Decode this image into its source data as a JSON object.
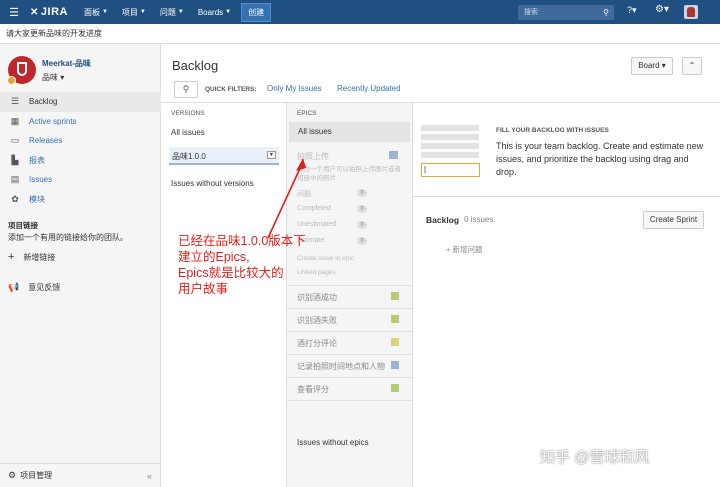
{
  "topbar": {
    "logo": "JIRA",
    "nav": [
      "面板",
      "项目",
      "问题",
      "Boards"
    ],
    "create": "创建",
    "search_placeholder": "搜索"
  },
  "announcement": "请大家更新品味的开发进度",
  "sidebar": {
    "project_name": "Meerkat-品味",
    "project_sub": "品味",
    "items": [
      {
        "label": "Backlog",
        "icon": "backlog-icon"
      },
      {
        "label": "Active sprints",
        "icon": "sprints-icon"
      },
      {
        "label": "Releases",
        "icon": "releases-icon"
      },
      {
        "label": "报表",
        "icon": "reports-icon"
      },
      {
        "label": "Issues",
        "icon": "issues-icon"
      },
      {
        "label": "模块",
        "icon": "components-icon"
      }
    ],
    "links_section": "项目链接",
    "links_desc": "添加一个有用的链接给你的团队。",
    "add_link": "新增链接",
    "feedback": "意见反馈",
    "footer": "项目管理"
  },
  "main": {
    "title": "Backlog",
    "board_button": "Board",
    "quick_filters_label": "QUICK FILTERS:",
    "quick_filters": [
      "Only My Issues",
      "Recently Updated"
    ]
  },
  "versions": {
    "header": "VERSIONS",
    "all": "All issues",
    "items": [
      "品味1.0.0"
    ],
    "none": "Issues without versions"
  },
  "epics": {
    "header": "EPICS",
    "all": "All issues",
    "first": {
      "name": "拍照上传",
      "desc": "作为一个用户可以拍照上传图片或者相册中的照片",
      "stats": [
        {
          "label": "问题",
          "value": "0"
        },
        {
          "label": "Completed",
          "value": "0"
        },
        {
          "label": "Unestimated",
          "value": "0"
        },
        {
          "label": "Estimate",
          "value": "0"
        }
      ],
      "link1": "Create issue in epic",
      "link2": "Linked pages"
    },
    "items": [
      {
        "name": "识别酒成功",
        "color": "#b7cc6e"
      },
      {
        "name": "识别酒失败",
        "color": "#b7cc6e"
      },
      {
        "name": "酒打分评论",
        "color": "#d9d57a"
      },
      {
        "name": "记录拍照时间地点和人物",
        "color": "#9ab5d4"
      },
      {
        "name": "查看评分",
        "color": "#b7cc6e"
      }
    ],
    "none": "Issues without epics"
  },
  "backlog_panel": {
    "fill_title": "FILL YOUR BACKLOG WITH ISSUES",
    "fill_text": "This is your team backlog. Create and estimate new issues, and prioritize the backlog using drag and drop.",
    "backlog_label": "Backlog",
    "backlog_count": "0 issues",
    "create_sprint": "Create Sprint",
    "new_issue": "新增问题"
  },
  "annotation": {
    "line1": "已经在品味1.0.0版本下",
    "line2": "建立的Epics,",
    "line3": "Epics就是比较大的",
    "line4": "用户故事"
  },
  "watermark": "知乎 @雪球和风"
}
